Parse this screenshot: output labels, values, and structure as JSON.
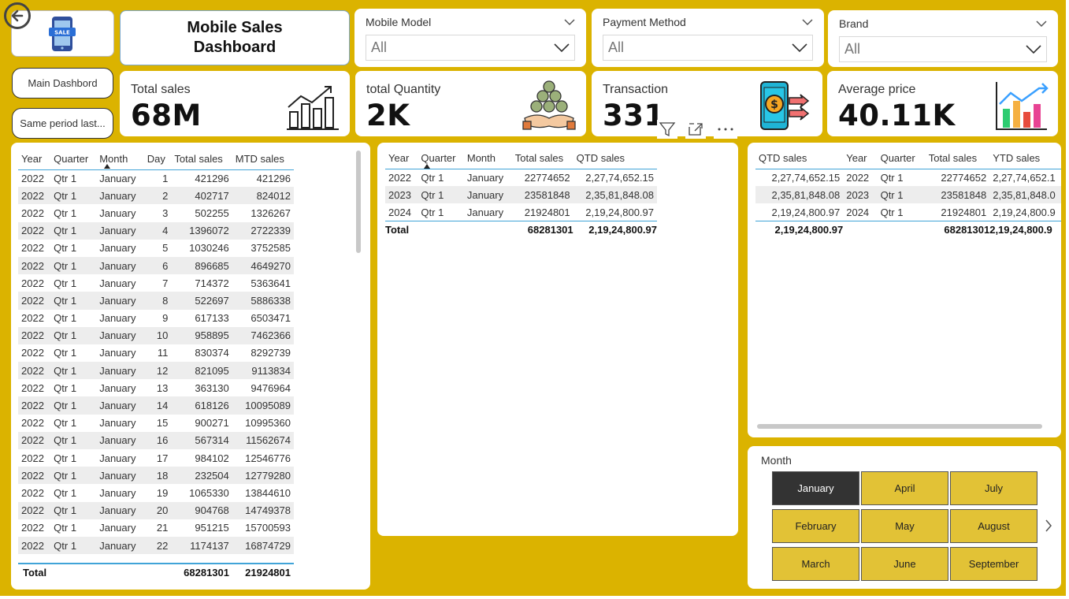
{
  "header": {
    "title_line1": "Mobile Sales",
    "title_line2": "Dashboard",
    "logo_text": "SALE"
  },
  "slicers": [
    {
      "label": "Mobile Model",
      "value": "All"
    },
    {
      "label": "Payment Method",
      "value": "All"
    },
    {
      "label": "Brand",
      "value": "All"
    }
  ],
  "nav": {
    "main": "Main Dashbord",
    "same_period": "Same period last..."
  },
  "kpis": [
    {
      "label": "Total sales",
      "value": "68M",
      "icon": "growth-chart-icon"
    },
    {
      "label": "total Quantity",
      "value": "2K",
      "icon": "money-bags-icon"
    },
    {
      "label": "Transaction",
      "value": "331",
      "icon": "mobile-payment-icon"
    },
    {
      "label": "Average price",
      "value": "40.11K",
      "icon": "bar-chart-icon"
    }
  ],
  "mtd_table": {
    "columns": [
      "Year",
      "Quarter",
      "Month",
      "Day",
      "Total sales",
      "MTD sales"
    ],
    "rows": [
      [
        "2022",
        "Qtr 1",
        "January",
        "1",
        "421296",
        "421296"
      ],
      [
        "2022",
        "Qtr 1",
        "January",
        "2",
        "402717",
        "824012"
      ],
      [
        "2022",
        "Qtr 1",
        "January",
        "3",
        "502255",
        "1326267"
      ],
      [
        "2022",
        "Qtr 1",
        "January",
        "4",
        "1396072",
        "2722339"
      ],
      [
        "2022",
        "Qtr 1",
        "January",
        "5",
        "1030246",
        "3752585"
      ],
      [
        "2022",
        "Qtr 1",
        "January",
        "6",
        "896685",
        "4649270"
      ],
      [
        "2022",
        "Qtr 1",
        "January",
        "7",
        "714372",
        "5363641"
      ],
      [
        "2022",
        "Qtr 1",
        "January",
        "8",
        "522697",
        "5886338"
      ],
      [
        "2022",
        "Qtr 1",
        "January",
        "9",
        "617133",
        "6503471"
      ],
      [
        "2022",
        "Qtr 1",
        "January",
        "10",
        "958895",
        "7462366"
      ],
      [
        "2022",
        "Qtr 1",
        "January",
        "11",
        "830374",
        "8292739"
      ],
      [
        "2022",
        "Qtr 1",
        "January",
        "12",
        "821095",
        "9113834"
      ],
      [
        "2022",
        "Qtr 1",
        "January",
        "13",
        "363130",
        "9476964"
      ],
      [
        "2022",
        "Qtr 1",
        "January",
        "14",
        "618126",
        "10095089"
      ],
      [
        "2022",
        "Qtr 1",
        "January",
        "15",
        "900271",
        "10995360"
      ],
      [
        "2022",
        "Qtr 1",
        "January",
        "16",
        "567314",
        "11562674"
      ],
      [
        "2022",
        "Qtr 1",
        "January",
        "17",
        "984102",
        "12546776"
      ],
      [
        "2022",
        "Qtr 1",
        "January",
        "18",
        "232504",
        "12779280"
      ],
      [
        "2022",
        "Qtr 1",
        "January",
        "19",
        "1065330",
        "13844610"
      ],
      [
        "2022",
        "Qtr 1",
        "January",
        "20",
        "904768",
        "14749378"
      ],
      [
        "2022",
        "Qtr 1",
        "January",
        "21",
        "951215",
        "15700593"
      ],
      [
        "2022",
        "Qtr 1",
        "January",
        "22",
        "1174137",
        "16874729"
      ]
    ],
    "total_label": "Total",
    "total_sales": "68281301",
    "total_mtd": "21924801"
  },
  "qtd_table": {
    "columns": [
      "Year",
      "Quarter",
      "Month",
      "Total sales",
      "QTD sales"
    ],
    "rows": [
      [
        "2022",
        "Qtr 1",
        "January",
        "22774652",
        "2,27,74,652.15"
      ],
      [
        "2023",
        "Qtr 1",
        "January",
        "23581848",
        "2,35,81,848.08"
      ],
      [
        "2024",
        "Qtr 1",
        "January",
        "21924801",
        "2,19,24,800.97"
      ]
    ],
    "total_label": "Total",
    "total_sales": "68281301",
    "total_qtd": "2,19,24,800.97"
  },
  "ytd_table": {
    "columns": [
      "QTD sales",
      "Year",
      "Quarter",
      "Total sales",
      "YTD sales"
    ],
    "rows": [
      [
        "2,27,74,652.15",
        "2022",
        "Qtr 1",
        "22774652",
        "2,27,74,652.1"
      ],
      [
        "2,35,81,848.08",
        "2023",
        "Qtr 1",
        "23581848",
        "2,35,81,848.0"
      ],
      [
        "2,19,24,800.97",
        "2024",
        "Qtr 1",
        "21924801",
        "2,19,24,800.9"
      ]
    ],
    "total_qtd": "2,19,24,800.97",
    "total_sales": "68281301",
    "total_ytd": "2,19,24,800.9"
  },
  "month_slicer": {
    "label": "Month",
    "months": [
      "January",
      "April",
      "July",
      "February",
      "May",
      "August",
      "March",
      "June",
      "September"
    ],
    "selected": "January"
  },
  "colors": {
    "canvas": "#dbb300",
    "month_button": "#e2c236",
    "month_selected": "#333333"
  }
}
